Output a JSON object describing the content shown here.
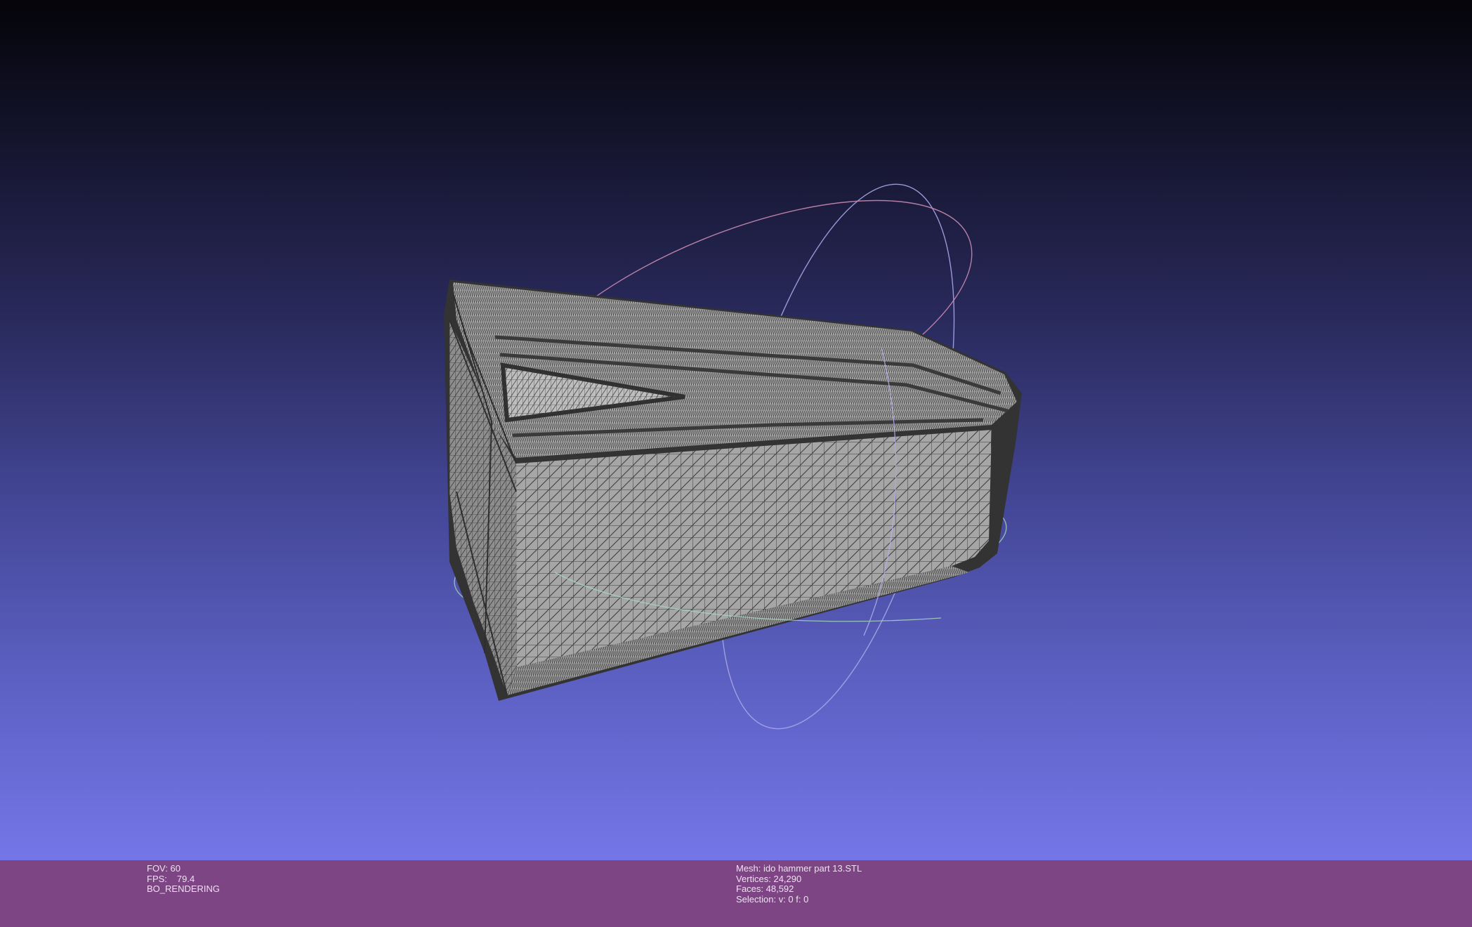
{
  "viewer": {
    "colors": {
      "background_top": "#040409",
      "background_bottom": "#7476e8",
      "mesh_fill": "#a4a4a4",
      "mesh_wire": "#3c3c3c",
      "info_bar": "#7e4585",
      "trackball_x": "#c98ab0",
      "trackball_y": "#a9a6e6",
      "trackball_z": "#98c7b4"
    }
  },
  "info_left": {
    "fov": "FOV: 60",
    "fps_label": "FPS:",
    "fps_value": "79.4",
    "rendering": "BO_RENDERING"
  },
  "info_right": {
    "mesh": "Mesh: ido hammer part 13.STL",
    "vertices": "Vertices: 24,290",
    "faces": "Faces: 48,592",
    "selection": "Selection: v: 0 f: 0"
  }
}
